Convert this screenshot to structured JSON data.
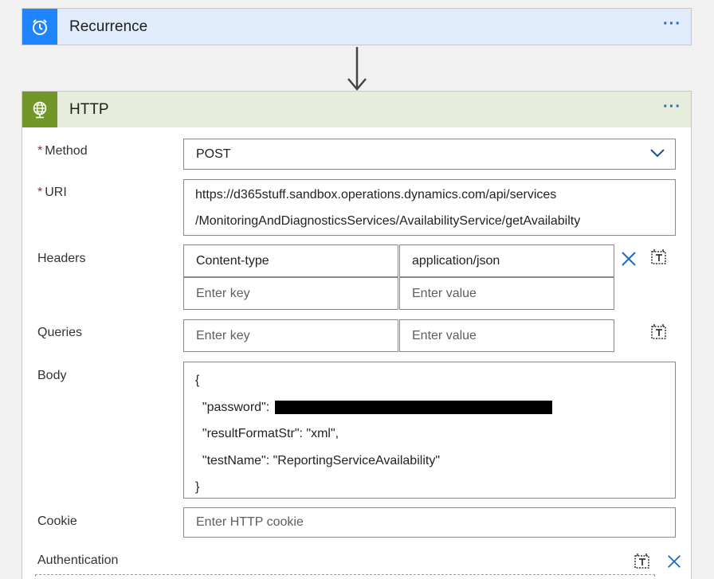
{
  "recurrence": {
    "title": "Recurrence",
    "icon": "alarm-clock-icon",
    "accent": "#1f85ff",
    "header_bg": "#e0ecfb"
  },
  "http": {
    "title": "HTTP",
    "icon": "globe-icon",
    "accent": "#709727",
    "header_bg": "#e6eedb",
    "more": "···"
  },
  "recurrence_more": "···",
  "method": {
    "label": "Method",
    "required_mark": "*",
    "value": "POST"
  },
  "uri": {
    "label": "URI",
    "required_mark": "*",
    "line1": "https://d365stuff.sandbox.operations.dynamics.com/api/services",
    "line2": "/MonitoringAndDiagnosticsServices/AvailabilityService/getAvailabilty"
  },
  "headers": {
    "label": "Headers",
    "rows": [
      {
        "key": "Content-type",
        "value": "application/json"
      }
    ],
    "key_placeholder": "Enter key",
    "value_placeholder": "Enter value"
  },
  "queries": {
    "label": "Queries",
    "key_placeholder": "Enter key",
    "value_placeholder": "Enter value"
  },
  "body": {
    "label": "Body",
    "open": "{",
    "password_key": "  \"password\": ",
    "line_format": "  \"resultFormatStr\": \"xml\",",
    "line_test": "  \"testName\": \"ReportingServiceAvailability\"",
    "close": "}"
  },
  "cookie": {
    "label": "Cookie",
    "placeholder": "Enter HTTP cookie"
  },
  "authentication": {
    "label": "Authentication"
  }
}
